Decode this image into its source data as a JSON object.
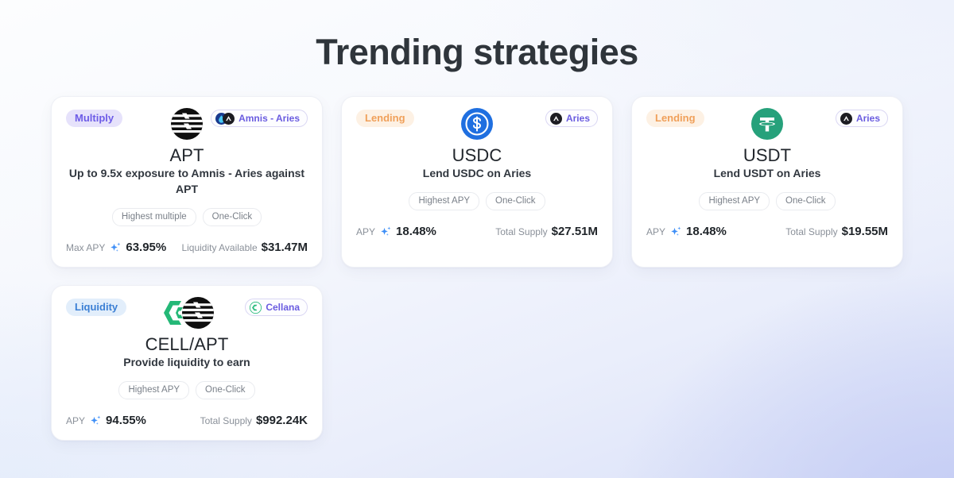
{
  "header": {
    "title": "Trending strategies"
  },
  "cards": [
    {
      "category": "Multiply",
      "category_style": "multiply",
      "protocol": "Amnis - Aries",
      "protocol_icons": [
        "amnis-icon",
        "aries-icon"
      ],
      "asset_logos": [
        "aptos-logo"
      ],
      "symbol": "APT",
      "description": "Up to 9.5x exposure to Amnis - Aries against APT",
      "pills": [
        "Highest multiple",
        "One-Click"
      ],
      "stat_left_label": "Max APY",
      "stat_left_value": "63.95%",
      "stat_right_label": "Liquidity Available",
      "stat_right_value": "$31.47M"
    },
    {
      "category": "Lending",
      "category_style": "lending",
      "protocol": "Aries",
      "protocol_icons": [
        "aries-icon"
      ],
      "asset_logos": [
        "usdc-logo"
      ],
      "symbol": "USDC",
      "description": "Lend USDC on Aries",
      "pills": [
        "Highest APY",
        "One-Click"
      ],
      "stat_left_label": "APY",
      "stat_left_value": "18.48%",
      "stat_right_label": "Total Supply",
      "stat_right_value": "$27.51M"
    },
    {
      "category": "Lending",
      "category_style": "lending",
      "protocol": "Aries",
      "protocol_icons": [
        "aries-icon"
      ],
      "asset_logos": [
        "usdt-logo"
      ],
      "symbol": "USDT",
      "description": "Lend USDT on Aries",
      "pills": [
        "Highest APY",
        "One-Click"
      ],
      "stat_left_label": "APY",
      "stat_left_value": "18.48%",
      "stat_right_label": "Total Supply",
      "stat_right_value": "$19.55M"
    },
    {
      "category": "Liquidity",
      "category_style": "liquidity",
      "protocol": "Cellana",
      "protocol_icons": [
        "cellana-icon"
      ],
      "asset_logos": [
        "cellana-logo",
        "aptos-logo"
      ],
      "symbol": "CELL/APT",
      "description": "Provide liquidity to earn",
      "pills": [
        "Highest APY",
        "One-Click"
      ],
      "stat_left_label": "APY",
      "stat_left_value": "94.55%",
      "stat_right_label": "Total Supply",
      "stat_right_value": "$992.24K"
    }
  ],
  "colors": {
    "multiply_text": "#6d5ce7",
    "multiply_bg": "#e6e2fb",
    "lending_text": "#f0a05a",
    "lending_bg": "#fdf1e4",
    "liquidity_text": "#3b7fd4",
    "liquidity_bg": "#e2eefb",
    "protocol_text": "#6a5ce0",
    "sparkle": "#3d8ef7",
    "title": "#2f353b",
    "usdc": "#1f6fe0",
    "usdt": "#26a17b",
    "cellana": "#23b573"
  }
}
